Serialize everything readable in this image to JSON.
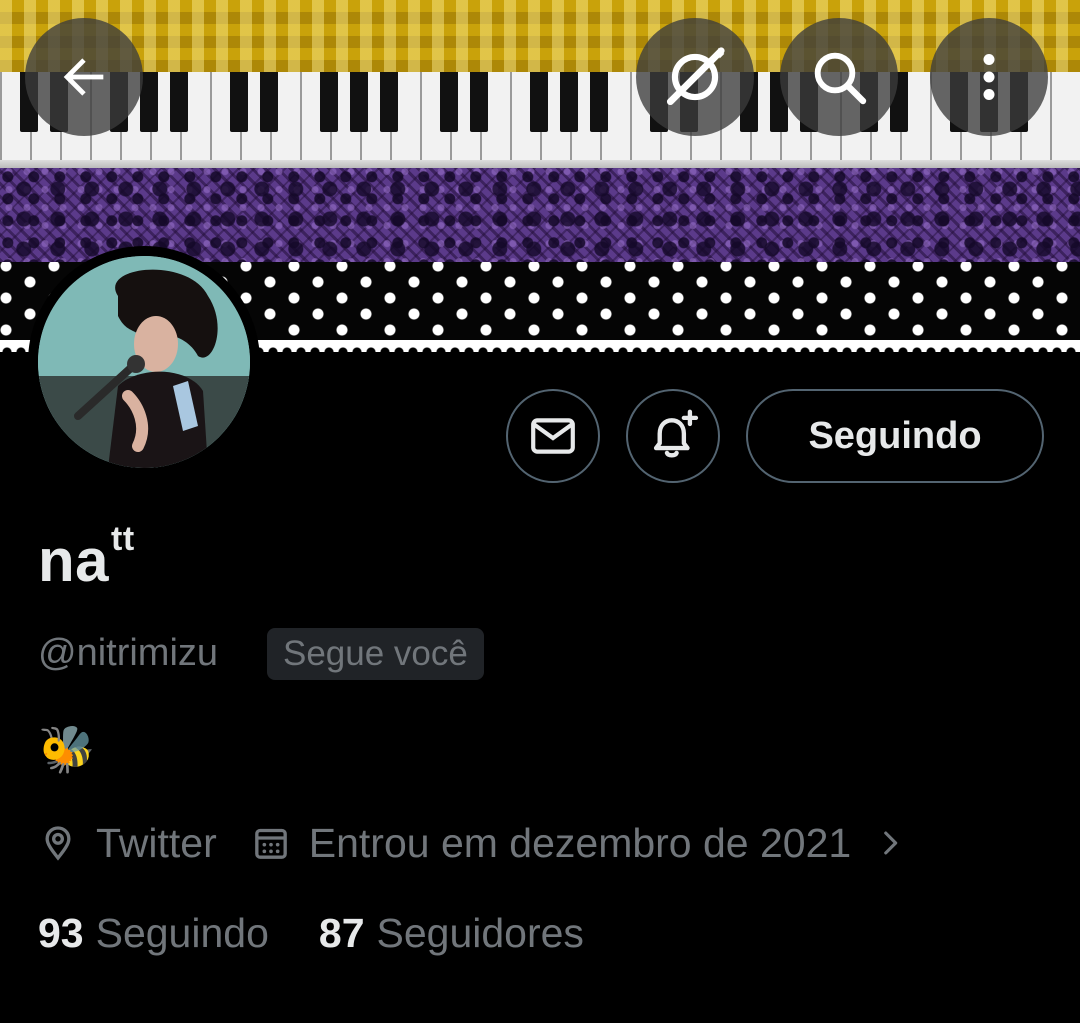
{
  "topbar": {
    "back_icon": "arrow-left-icon",
    "sync_icon": "sync-slash-icon",
    "search_icon": "search-icon",
    "more_icon": "more-vertical-icon"
  },
  "banner": {
    "colors": {
      "gingham": "#c9a20a",
      "lace": "#5b3a8a",
      "dots_bg": "#050505"
    }
  },
  "profile": {
    "name": "na",
    "name_superscript": "tt",
    "handle": "@nitrimizu",
    "follows_you": "Segue você",
    "bio": "🐝",
    "location": "Twitter",
    "joined": "Entrou em dezembro de 2021"
  },
  "actions": {
    "message_icon": "envelope-icon",
    "notify_icon": "bell-plus-icon",
    "follow_label": "Seguindo"
  },
  "stats": {
    "following_count": "93",
    "following_label": "Seguindo",
    "followers_count": "87",
    "followers_label": "Seguidores"
  },
  "colors": {
    "text_primary": "#e7e9ea",
    "text_secondary": "#71767b",
    "border": "#536471",
    "badge_bg": "#202327"
  }
}
